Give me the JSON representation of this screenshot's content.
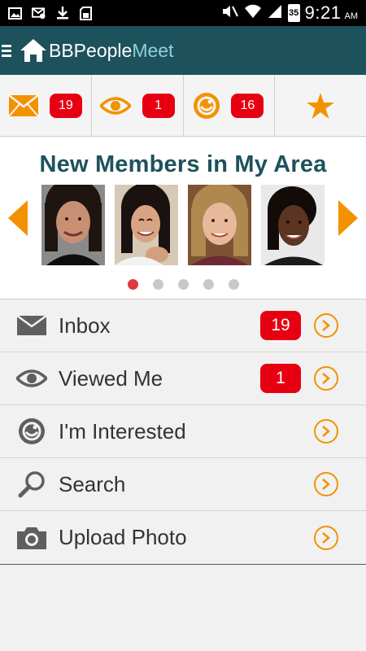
{
  "status": {
    "battery": "35",
    "time": "9:21",
    "ampm": "AM"
  },
  "appbar": {
    "brand_main": "BBPeople",
    "brand_accent": "Meet"
  },
  "stats": [
    {
      "icon": "mail-icon",
      "count": "19"
    },
    {
      "icon": "eye-icon",
      "count": "1"
    },
    {
      "icon": "smiley-icon",
      "count": "16"
    },
    {
      "icon": "star-icon"
    }
  ],
  "members": {
    "title": "New Members in My Area",
    "photos": [
      "member-photo-1",
      "member-photo-2",
      "member-photo-3",
      "member-photo-4"
    ],
    "dots": 5,
    "active_dot": 0
  },
  "menu": [
    {
      "label": "Inbox",
      "badge": "19",
      "icon": "mail-icon"
    },
    {
      "label": "Viewed Me",
      "badge": "1",
      "icon": "eye-icon"
    },
    {
      "label": "I'm Interested",
      "icon": "smiley-icon"
    },
    {
      "label": "Search",
      "icon": "search-icon"
    },
    {
      "label": "Upload Photo",
      "icon": "camera-icon"
    }
  ],
  "colors": {
    "header": "#1d525d",
    "accent": "#f39200",
    "badge": "#e60012"
  }
}
